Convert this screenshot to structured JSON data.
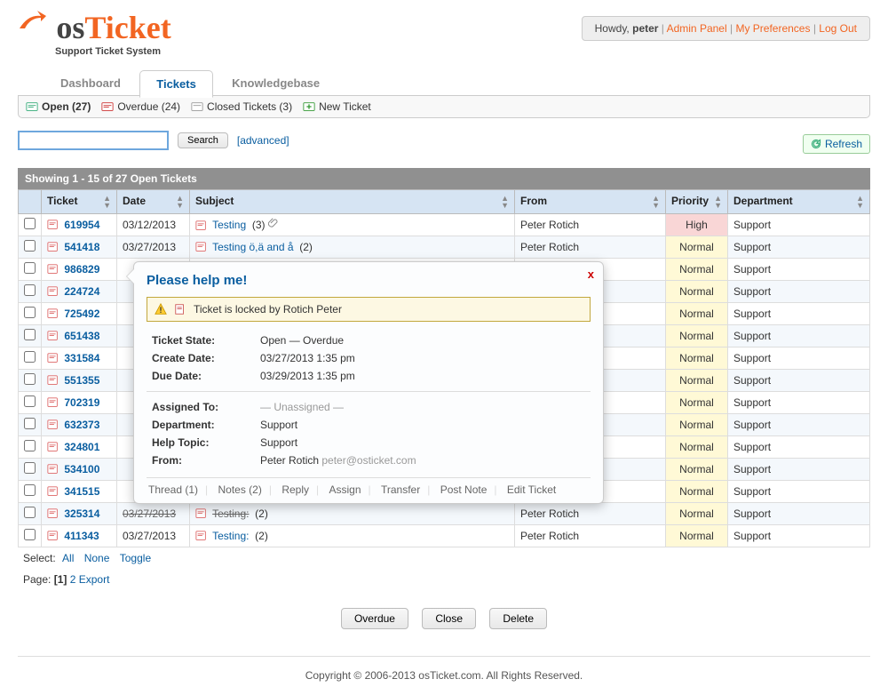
{
  "userbar": {
    "greeting": "Howdy,",
    "username": "peter",
    "admin": "Admin Panel",
    "prefs": "My Preferences",
    "logout": "Log Out"
  },
  "logo": {
    "brand_prefix": "os",
    "brand_main": "Ticket",
    "tagline": "Support Ticket System"
  },
  "tabs": {
    "dashboard": "Dashboard",
    "tickets": "Tickets",
    "kb": "Knowledgebase"
  },
  "subnav": {
    "open": "Open (27)",
    "overdue": "Overdue (24)",
    "closed": "Closed Tickets (3)",
    "new": "New Ticket"
  },
  "search": {
    "button": "Search",
    "advanced": "[advanced]",
    "placeholder": ""
  },
  "refresh": "Refresh",
  "status_bar": "Showing  1 - 15 of 27   Open Tickets",
  "columns": {
    "ticket": "Ticket",
    "date": "Date",
    "subject": "Subject",
    "from": "From",
    "priority": "Priority",
    "department": "Department"
  },
  "tickets": [
    {
      "id": "619954",
      "date": "03/12/2013",
      "subject": "Testing",
      "count": "(3)",
      "attach": true,
      "from": "Peter Rotich",
      "priority": "High",
      "dept": "Support"
    },
    {
      "id": "541418",
      "date": "03/27/2013",
      "subject": "Testing ö,ä and å",
      "count": "(2)",
      "from": "Peter Rotich",
      "priority": "Normal",
      "dept": "Support"
    },
    {
      "id": "986829",
      "priority": "Normal",
      "dept": "Support"
    },
    {
      "id": "224724",
      "priority": "Normal",
      "dept": "Support"
    },
    {
      "id": "725492",
      "priority": "Normal",
      "dept": "Support"
    },
    {
      "id": "651438",
      "priority": "Normal",
      "dept": "Support"
    },
    {
      "id": "331584",
      "priority": "Normal",
      "dept": "Support"
    },
    {
      "id": "551355",
      "priority": "Normal",
      "dept": "Support"
    },
    {
      "id": "702319",
      "priority": "Normal",
      "dept": "Support"
    },
    {
      "id": "632373",
      "priority": "Normal",
      "dept": "Support"
    },
    {
      "id": "324801",
      "priority": "Normal",
      "dept": "Support"
    },
    {
      "id": "534100",
      "priority": "Normal",
      "dept": "Support"
    },
    {
      "id": "341515",
      "priority": "Normal",
      "dept": "Support"
    },
    {
      "id": "325314",
      "date": "03/27/2013",
      "subject": "Testing:",
      "count": "(2)",
      "from": "Peter Rotich",
      "priority": "Normal",
      "dept": "Support",
      "strike": true
    },
    {
      "id": "411343",
      "date": "03/27/2013",
      "subject": "Testing:",
      "count": "(2)",
      "from": "Peter Rotich",
      "priority": "Normal",
      "dept": "Support"
    }
  ],
  "select_row": {
    "label": "Select:",
    "all": "All",
    "none": "None",
    "toggle": "Toggle"
  },
  "page_row": {
    "label": "Page:",
    "current": "[1]",
    "next": "2",
    "export": "Export"
  },
  "action_buttons": {
    "overdue": "Overdue",
    "close": "Close",
    "delete": "Delete"
  },
  "footer": "Copyright © 2006-2013 osTicket.com.  All Rights Reserved.",
  "popup": {
    "title": "Please help me!",
    "lock_msg": "Ticket is locked by Rotich Peter",
    "state_label": "Ticket State:",
    "state_val": "Open — Overdue",
    "create_label": "Create Date:",
    "create_val": "03/27/2013 1:35 pm",
    "due_label": "Due Date:",
    "due_val": "03/29/2013 1:35 pm",
    "assigned_label": "Assigned To:",
    "assigned_val": "— Unassigned —",
    "dept_label": "Department:",
    "dept_val": "Support",
    "topic_label": "Help Topic:",
    "topic_val": "Support",
    "from_label": "From:",
    "from_name": "Peter Rotich",
    "from_email": "peter@osticket.com",
    "actions": {
      "thread": "Thread (1)",
      "notes": "Notes (2)",
      "reply": "Reply",
      "assign": "Assign",
      "transfer": "Transfer",
      "postnote": "Post Note",
      "edit": "Edit Ticket"
    }
  }
}
